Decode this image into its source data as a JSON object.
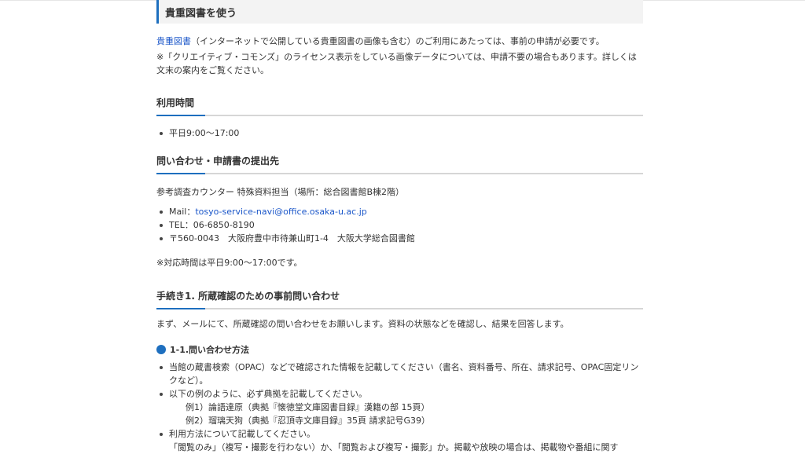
{
  "page_title": "貴重図書を使う",
  "intro": {
    "link_text": "貴重図書",
    "text_after_link": "（インターネットで公開している貴重図書の画像も含む）のご利用にあたっては、事前の申請が必要です。",
    "note": "※「クリエイティブ・コモンズ」のライセンス表示をしている画像データについては、申請不要の場合もあります。詳しくは文末の案内をご覧ください。"
  },
  "hours": {
    "heading": "利用時間",
    "items": [
      "平日9:00～17:00"
    ]
  },
  "contact": {
    "heading": "問い合わせ・申請書の提出先",
    "desk": "参考調査カウンター 特殊資料担当（場所：総合図書館B棟2階）",
    "mail_label": "Mail：",
    "mail_address": "tosyo-service-navi@office.osaka-u.ac.jp",
    "tel": "TEL：06-6850-8190",
    "address": "〒560-0043　大阪府豊中市待兼山町1-4　大阪大学総合図書館",
    "note": "※対応時間は平日9:00～17:00です。"
  },
  "step1": {
    "heading": "手続き1. 所蔵確認のための事前問い合わせ",
    "intro": "まず、メールにて、所蔵確認の問い合わせをお願いします。資料の状態などを確認し、結果を回答します。",
    "sub_heading": "1-1.問い合わせ方法",
    "item1": "当館の蔵書検索（OPAC）などで確認された情報を記載してください（書名、資料番号、所在、請求記号、OPAC固定リンクなど）。",
    "item2": "以下の例のように、必ず典拠を記載してください。",
    "example1": "例1）論語達原（典拠『懐徳堂文庫図書目録』漢籍の部 15頁）",
    "example2": "例2）瑠璃天狗（典拠『忍頂寺文庫目録』35頁 請求記号G39）",
    "item3": "利用方法について記載してください。",
    "item3_detail": "「閲覧のみ」（複写・撮影を行わない）か、「閲覧および複写・撮影」か。掲載や放映の場合は、掲載物や番組に関す"
  }
}
